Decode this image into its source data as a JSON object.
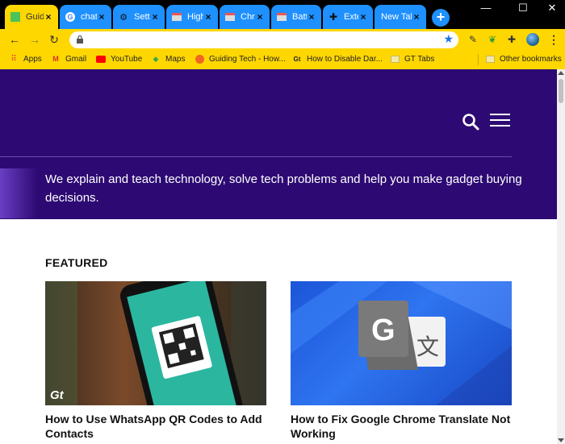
{
  "browser": {
    "tabs": [
      {
        "title": "Guiding Tech",
        "active": true,
        "favicon": "green-square-icon"
      },
      {
        "title": "chatgpt",
        "active": false,
        "favicon": "google-icon"
      },
      {
        "title": "Settings",
        "active": false,
        "favicon": "gear-icon"
      },
      {
        "title": "High",
        "active": false,
        "favicon": "page-icon"
      },
      {
        "title": "Chrome",
        "active": false,
        "favicon": "page-icon"
      },
      {
        "title": "Battery",
        "active": false,
        "favicon": "page-icon"
      },
      {
        "title": "Extensions",
        "active": false,
        "favicon": "puzzle-icon"
      },
      {
        "title": "New Tab",
        "active": false,
        "favicon": ""
      }
    ],
    "new_tab_label": "+",
    "window_controls": [
      "—",
      "☐",
      "✕"
    ],
    "omnibox_value": "",
    "bookmarks": [
      {
        "label": "Apps",
        "icon": "apps-grid-icon"
      },
      {
        "label": "Gmail",
        "icon": "gmail-icon"
      },
      {
        "label": "YouTube",
        "icon": "youtube-icon"
      },
      {
        "label": "Maps",
        "icon": "maps-icon"
      },
      {
        "label": "Guiding Tech - How...",
        "icon": "orange-circle-icon"
      },
      {
        "label": "How to Disable Dar...",
        "icon": "gt-logo-icon"
      },
      {
        "label": "GT Tabs",
        "icon": "folder-icon"
      },
      {
        "label": "Other bookmarks",
        "icon": "folder-icon"
      }
    ],
    "colors": {
      "tab_inactive": "#1e90ff",
      "toolbar": "#ffd700",
      "frame": "#000000"
    }
  },
  "page": {
    "tagline": "We explain and teach technology, solve tech problems and help you make gadget buying decisions.",
    "section_title": "FEATURED",
    "cards": [
      {
        "title": "How to Use WhatsApp QR Codes to Add Contacts",
        "badge": "Gt"
      },
      {
        "title": "How to Fix Google Chrome Translate Not Working",
        "badge": "G"
      }
    ],
    "colors": {
      "hero": "#2d0a73"
    }
  }
}
